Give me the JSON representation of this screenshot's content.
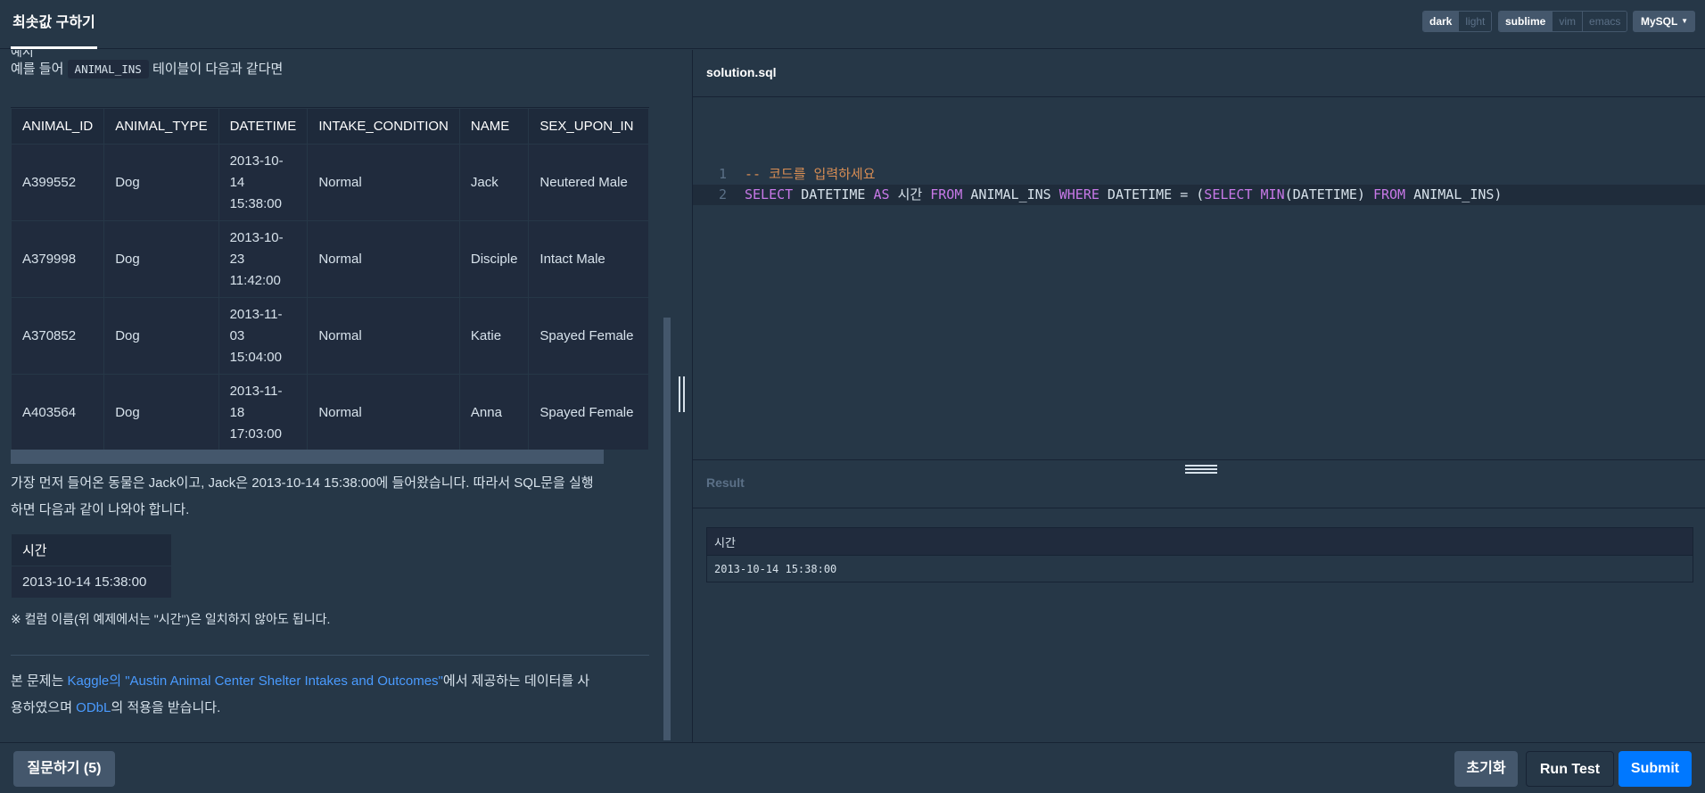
{
  "header": {
    "tab_title": "최솟값 구하기",
    "theme_options": [
      "dark",
      "light"
    ],
    "keymap_options": [
      "sublime",
      "vim",
      "emacs"
    ],
    "language": "MySQL"
  },
  "left": {
    "cut_heading": "예시",
    "intro_prefix": "예를 들어 ",
    "intro_code": "ANIMAL_INS",
    "intro_suffix": " 테이블이 다음과 같다면",
    "table": {
      "headers": [
        "ANIMAL_ID",
        "ANIMAL_TYPE",
        "DATETIME",
        "INTAKE_CONDITION",
        "NAME",
        "SEX_UPON_IN"
      ],
      "rows": [
        [
          "A399552",
          "Dog",
          "2013-10-14 15:38:00",
          "Normal",
          "Jack",
          "Neutered Male"
        ],
        [
          "A379998",
          "Dog",
          "2013-10-23 11:42:00",
          "Normal",
          "Disciple",
          "Intact Male"
        ],
        [
          "A370852",
          "Dog",
          "2013-11-03 15:04:00",
          "Normal",
          "Katie",
          "Spayed Female"
        ],
        [
          "A403564",
          "Dog",
          "2013-11-18 17:03:00",
          "Normal",
          "Anna",
          "Spayed Female"
        ]
      ]
    },
    "explanation_line1": "가장 먼저 들어온 동물은 Jack이고, Jack은 2013-10-14 15:38:00에 들어왔습니다. 따라서 SQL문을 실행",
    "explanation_line2": "하면 다음과 같이 나와야 합니다.",
    "expected": {
      "header": "시간",
      "value": "2013-10-14 15:38:00"
    },
    "note": "※ 컬럼 이름(위 예제에서는 \"시간\")은 일치하지 않아도 됩니다.",
    "license_prefix": "본 문제는 ",
    "license_link1": "Kaggle의 \"Austin Animal Center Shelter Intakes and Outcomes\"",
    "license_mid": "에서 제공하는 데이터를 사",
    "license_line2_prefix": "용하였으며 ",
    "license_link2": "ODbL",
    "license_suffix": "의 적용을 받습니다."
  },
  "editor": {
    "file_name": "solution.sql",
    "line_numbers": [
      "1",
      "2"
    ],
    "line1": "-- 코드를 입력하세요",
    "line2_tokens": [
      "SELECT",
      " DATETIME ",
      "AS",
      " 시간 ",
      "FROM",
      " ANIMAL_INS ",
      "WHERE",
      " DATETIME = (",
      "SELECT",
      " ",
      "MIN",
      "(DATETIME) ",
      "FROM",
      " ANIMAL_INS)"
    ]
  },
  "result": {
    "label": "Result",
    "header": "시간",
    "value": "2013-10-14 15:38:00"
  },
  "footer": {
    "ask_button": "질문하기 (5)",
    "reset_button": "초기화",
    "run_button": "Run Test",
    "submit_button": "Submit"
  },
  "colors": {
    "background": "#263747",
    "keyword": "#c879e8",
    "comment": "#d98e54",
    "link": "#4a9bff",
    "submit": "#0078ff"
  }
}
